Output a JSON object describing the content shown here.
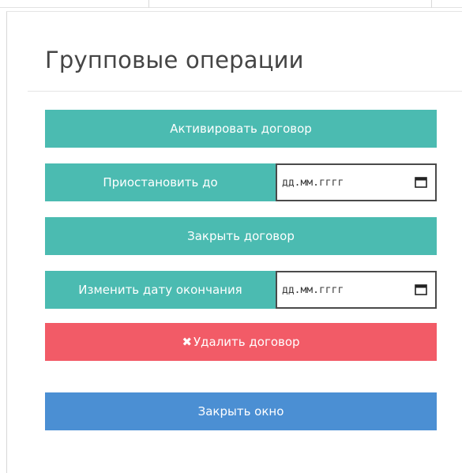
{
  "panel": {
    "title": "Групповые операции"
  },
  "actions": {
    "activate_label": "Активировать договор",
    "suspend_label": "Приостановить до",
    "suspend_date_placeholder": "дд.мм.гггг",
    "close_contract_label": "Закрыть договор",
    "change_end_date_label": "Изменить дату окончания",
    "end_date_placeholder": "дд.мм.гггг",
    "delete_icon": "✖",
    "delete_label": "Удалить договор",
    "close_window_label": "Закрыть окно"
  },
  "colors": {
    "teal": "#4bbbb1",
    "red": "#f25b67",
    "blue": "#4b8fd3"
  },
  "icons": {
    "date_picker": "calendar-icon",
    "delete": "close-icon"
  }
}
